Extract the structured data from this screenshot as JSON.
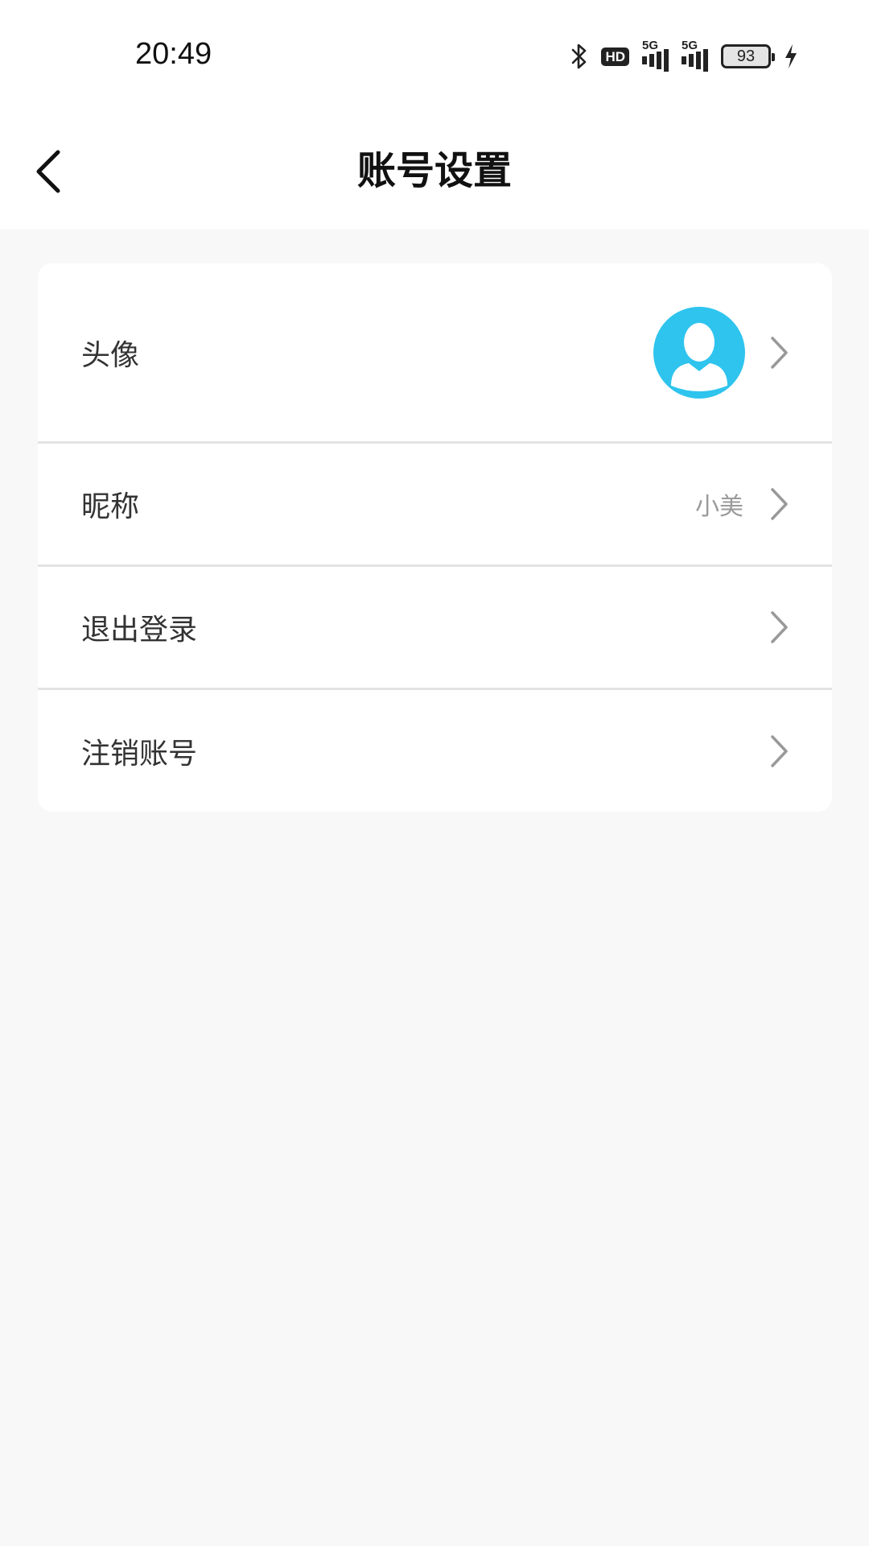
{
  "status_bar": {
    "time": "20:49",
    "icons": [
      "bluetooth-icon",
      "hd-icon",
      "signal-5g-icon",
      "signal-5g-icon",
      "battery-icon",
      "charging-icon"
    ],
    "hd_label": "HD",
    "network_label_1": "5G",
    "network_label_2": "5G",
    "battery_level": "93"
  },
  "header": {
    "title": "账号设置",
    "back_icon": "chevron-left-icon"
  },
  "settings": {
    "avatar": {
      "label": "头像",
      "avatar_color": "#2ec4ee",
      "icon": "user-silhouette-icon"
    },
    "nickname": {
      "label": "昵称",
      "value": "小美"
    },
    "logout": {
      "label": "退出登录"
    },
    "delete_account": {
      "label": "注销账号"
    }
  },
  "colors": {
    "page_background": "#f8f8f8",
    "card_background": "#ffffff",
    "accent": "#2ec4ee",
    "divider": "#e3e3e3",
    "chevron": "#999999"
  }
}
